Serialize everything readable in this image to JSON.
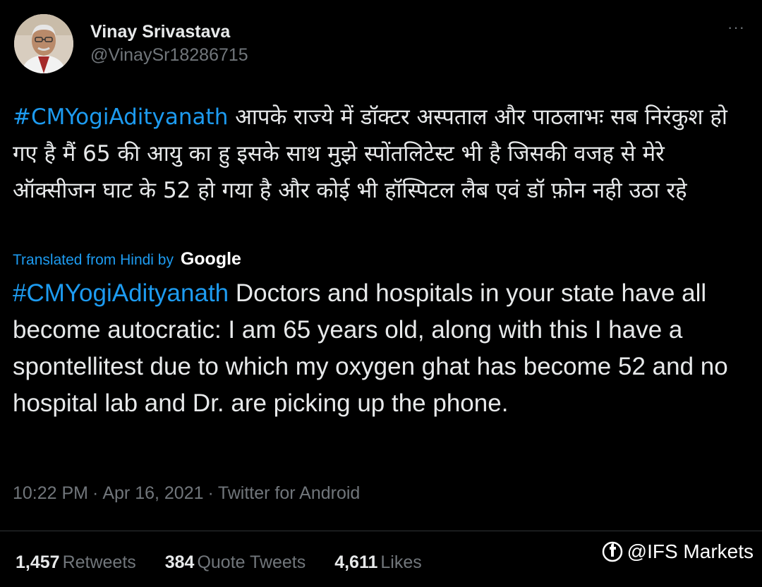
{
  "tweet": {
    "display_name": "Vinay Srivastava",
    "handle": "@VinaySr18286715",
    "more_icon": "···",
    "original": {
      "hashtag": "#CMYogiAdityanath",
      "text": "आपके राज्ये में डॉक्टर अस्पताल और पाठलाभः सब निरंकुश हो गए है मैं 65 की आयु का हु इसके साथ मुझे स्पोंतलिटेस्ट  भी है जिसकी वजह से मेरे ऑक्सीजन घाट के 52 हो गया है और कोई भी हॉस्पिटल लैब एवं डॉ फ़ोन नही उठा रहे"
    },
    "translated_label": "Translated from Hindi by",
    "translation_provider": "Google",
    "translation": {
      "hashtag": "#CMYogiAdityanath",
      "text": "Doctors and hospitals in your state have all become autocratic: I am 65 years old, along with this I have a spontellitest due to which my oxygen ghat has become 52 and no hospital lab and Dr. are picking up the phone."
    },
    "time": "10:22 PM",
    "date": "Apr 16, 2021",
    "source": "Twitter for Android",
    "separator": "·",
    "stats": {
      "retweets_count": "1,457",
      "retweets_label": "Retweets",
      "quotes_count": "384",
      "quotes_label": "Quote Tweets",
      "likes_count": "4,611",
      "likes_label": "Likes"
    }
  },
  "watermark": {
    "text": "@IFS Markets"
  },
  "colors": {
    "background": "#000000",
    "text": "#e7e9ea",
    "secondary": "#71767b",
    "accent": "#1d9bf0"
  }
}
